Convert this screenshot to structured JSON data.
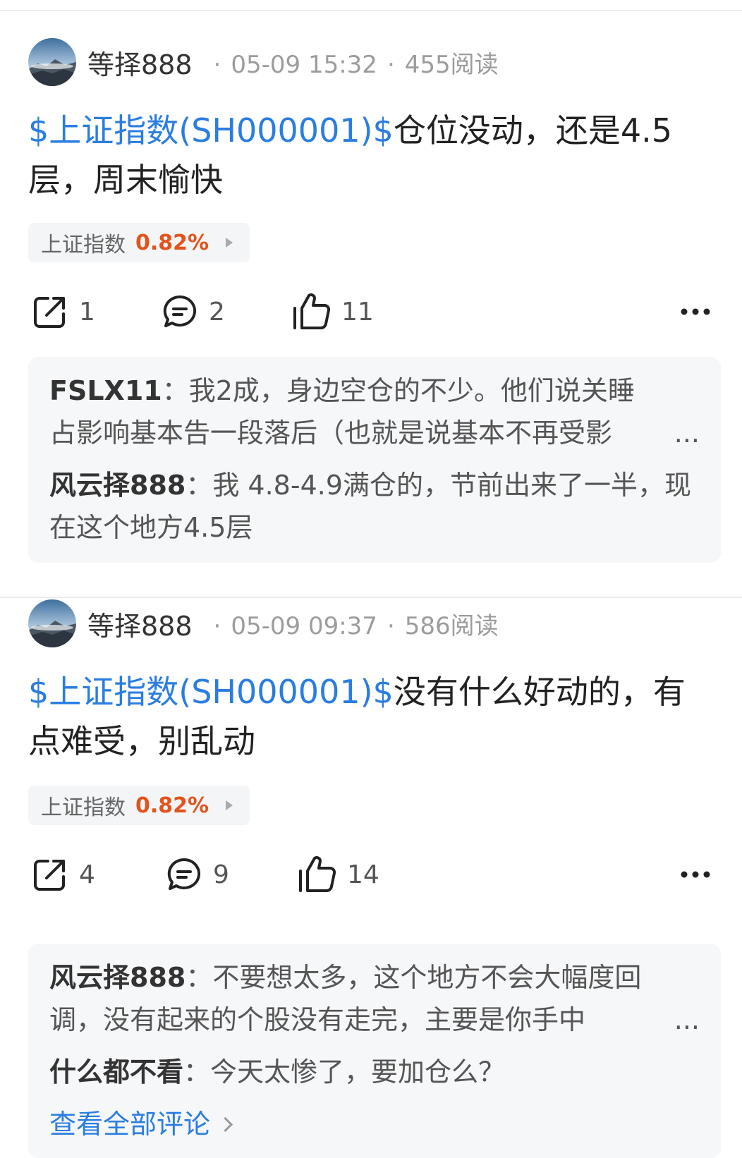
{
  "posts": [
    {
      "author": "等择888",
      "time": "05-09 15:32",
      "reads": "455阅读",
      "stock_tag": "$上证指数(SH000001)$",
      "text": "仓位没动，还是4.5层，周末愉快",
      "chip": {
        "name": "上证指数",
        "change": "0.82%"
      },
      "actions": {
        "shares": "1",
        "comments": "2",
        "likes": "11"
      },
      "comments": [
        {
          "author": "FSLX11",
          "text": "我2成，身边空仓的不少。他们说关睡占影响基本告一段落后（也就是说基本不再受影",
          "truncated": true
        },
        {
          "author": "风云择888",
          "text": "我 4.8-4.9满仓的，节前出来了一半，现在这个地方4.5层",
          "truncated": false
        }
      ],
      "view_all": ""
    },
    {
      "author": "等择888",
      "time": "05-09 09:37",
      "reads": "586阅读",
      "stock_tag": "$上证指数(SH000001)$",
      "text": "没有什么好动的，有点难受，别乱动",
      "chip": {
        "name": "上证指数",
        "change": "0.82%"
      },
      "actions": {
        "shares": "4",
        "comments": "9",
        "likes": "14"
      },
      "comments": [
        {
          "author": "风云择888",
          "text": "不要想太多，这个地方不会大幅度回调，没有起来的个股没有走完，主要是你手中",
          "truncated": true
        },
        {
          "author": "什么都不看",
          "text": "今天太惨了，要加仓么？",
          "truncated": false
        }
      ],
      "view_all": "查看全部评论"
    }
  ],
  "ui": {
    "separator_dot": "·",
    "colon": "：",
    "ellipsis": "...",
    "accent_color": "#2a7de1",
    "rise_color": "#e2541c",
    "icons": [
      "share-icon",
      "comment-icon",
      "like-icon",
      "more-icon",
      "chevron-right-icon"
    ]
  }
}
